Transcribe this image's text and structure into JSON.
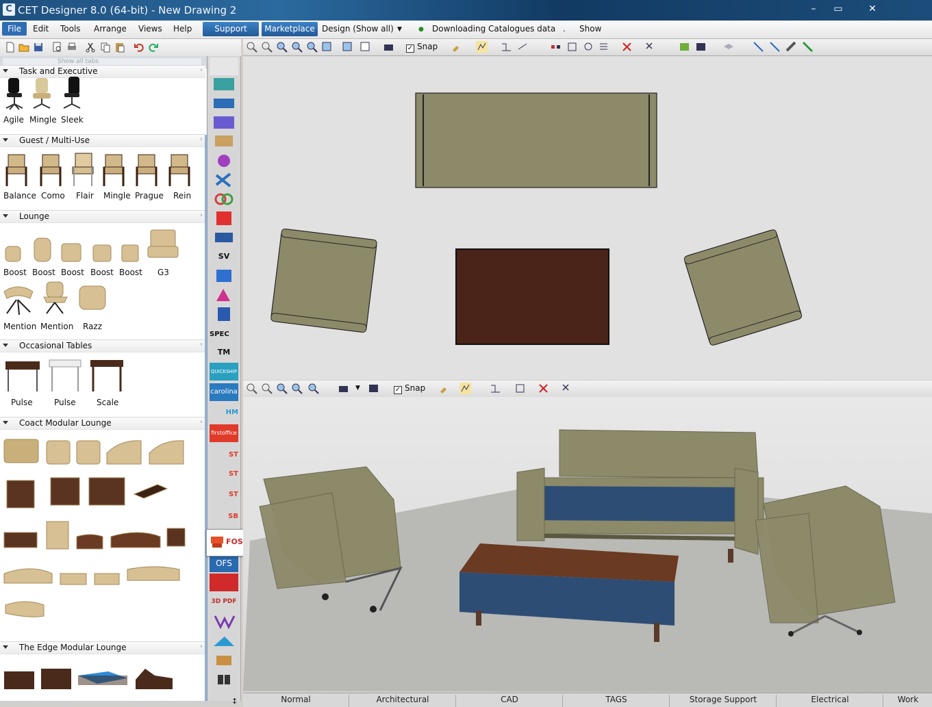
{
  "window": {
    "title": "CET Designer 8.0 (64-bit) - New Drawing 2",
    "app_icon": "cet-app-icon"
  },
  "menubar": {
    "items": [
      "File",
      "Edit",
      "Tools",
      "Arrange",
      "Views",
      "Help"
    ],
    "support": "Support",
    "marketplace": "Marketplace",
    "design_mode": "Design (Show all)",
    "status": "Downloading Catalogues data",
    "dot": ".",
    "show": "Show"
  },
  "sidepanel": {
    "search_placeholder": "Show all tabs",
    "sections": [
      {
        "title": "Task and Executive",
        "items": [
          "Agile",
          "Mingle",
          "Sleek"
        ]
      },
      {
        "title": "Guest / Multi-Use",
        "items": [
          "Balance",
          "Como",
          "Flair",
          "Mingle",
          "Prague",
          "Rein"
        ]
      },
      {
        "title": "Lounge",
        "items": [
          "Boost",
          "Boost",
          "Boost",
          "Boost",
          "Boost",
          "G3",
          "Mention",
          "Mention",
          "Razz"
        ]
      },
      {
        "title": "Occasional Tables",
        "items": [
          "Pulse",
          "Pulse",
          "Scale"
        ]
      },
      {
        "title": "Coact Modular Lounge",
        "items": []
      },
      {
        "title": "The Edge Modular Lounge",
        "items": []
      }
    ]
  },
  "vstrip": {
    "labels": [
      "SV",
      "SPEC",
      "TM",
      "QUICKSHIP",
      "carolina",
      "HM",
      "firstoffice",
      "ST",
      "ST",
      "ST",
      "SB",
      "FOS",
      "OFS",
      "3D PDF"
    ]
  },
  "view_toolbar": {
    "snap_label": "Snap",
    "snap_checked": "✓"
  },
  "bottom_tabs": [
    "Normal",
    "Architectural",
    "CAD",
    "TAGS",
    "Storage Support",
    "Electrical",
    "Work"
  ],
  "colors": {
    "sofa_fill": "#8d8a6a",
    "table_fill": "#4a2418",
    "menu_accent": "#2f6db3",
    "carpet": "#b9b9b5",
    "sofa_seat": "#2d4d75"
  }
}
